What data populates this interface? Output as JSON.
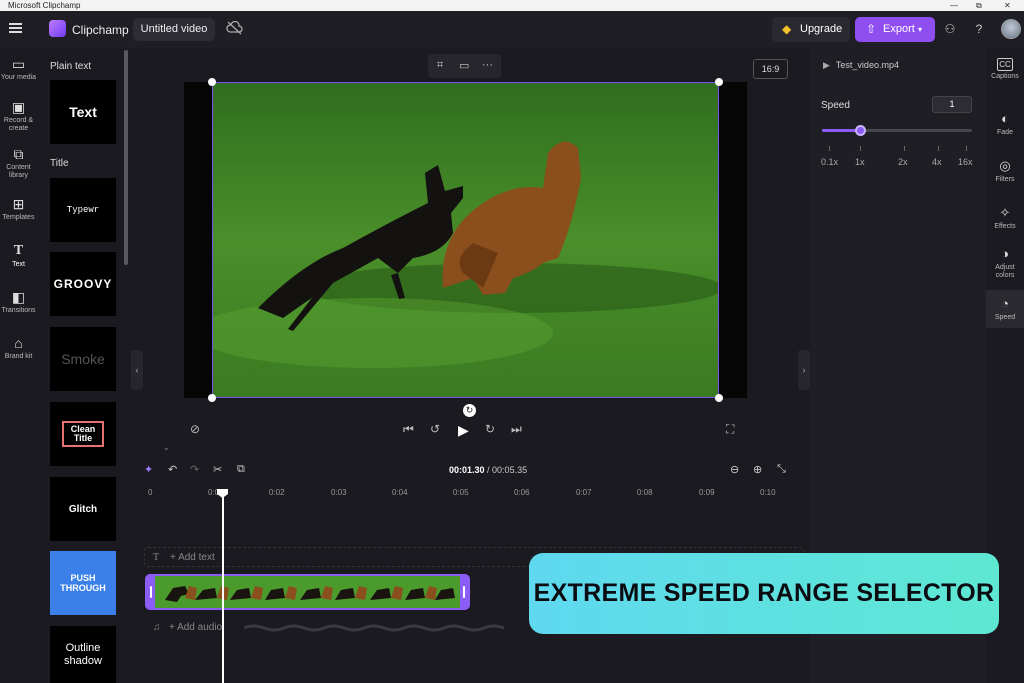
{
  "os": {
    "window_title": "Microsoft Clipchamp",
    "controls": [
      "—",
      "⧉",
      "✕"
    ]
  },
  "header": {
    "app_name": "Clipchamp",
    "project_title": "Untitled video",
    "upgrade_label": "Upgrade",
    "export_label": "Export"
  },
  "left_rail": {
    "items": [
      {
        "icon": "folder-icon",
        "label": "Your media"
      },
      {
        "icon": "camera-icon",
        "label": "Record & create"
      },
      {
        "icon": "library-icon",
        "label": "Content library"
      },
      {
        "icon": "templates-icon",
        "label": "Templates"
      },
      {
        "icon": "text-icon",
        "label": "Text"
      },
      {
        "icon": "transitions-icon",
        "label": "Transitions"
      },
      {
        "icon": "brand-kit-icon",
        "label": "Brand kit"
      }
    ]
  },
  "text_panel": {
    "section_plain": "Plain text",
    "section_title": "Title",
    "tiles": [
      "Text",
      "Typewr",
      "GROOVY",
      "Smoke",
      "Clean Title",
      "Glitch",
      "PUSH THROUGH",
      "Outline shadow"
    ]
  },
  "preview": {
    "aspect_ratio": "16:9"
  },
  "timeline": {
    "current_time": "00:01.30",
    "total_time": "/ 00:05.35",
    "ruler_labels": [
      "0",
      "0:01",
      "0:02",
      "0:03",
      "0:04",
      "0:05",
      "0:06",
      "0:07",
      "0:08",
      "0:09",
      "0:10"
    ],
    "add_text": "+ Add text",
    "add_audio": "+ Add audio"
  },
  "speed_panel": {
    "file_name": "Test_video.mp4",
    "label": "Speed",
    "value": "1",
    "slider_fraction": 0.25,
    "tick_labels": [
      "0.1x",
      "1x",
      "2x",
      "4x",
      "16x"
    ]
  },
  "right_rail": {
    "items": [
      {
        "icon": "captions-icon",
        "label": "Captions"
      },
      {
        "icon": "fade-icon",
        "label": "Fade"
      },
      {
        "icon": "filters-icon",
        "label": "Filters"
      },
      {
        "icon": "effects-icon",
        "label": "Effects"
      },
      {
        "icon": "adjust-colors-icon",
        "label": "Adjust colors"
      },
      {
        "icon": "speed-icon",
        "label": "Speed"
      }
    ]
  },
  "callout": {
    "text": "EXTREME SPEED RANGE SELECTOR"
  },
  "colors": {
    "accent": "#8b5cf6",
    "callout_bg": "#5ee0e0"
  }
}
